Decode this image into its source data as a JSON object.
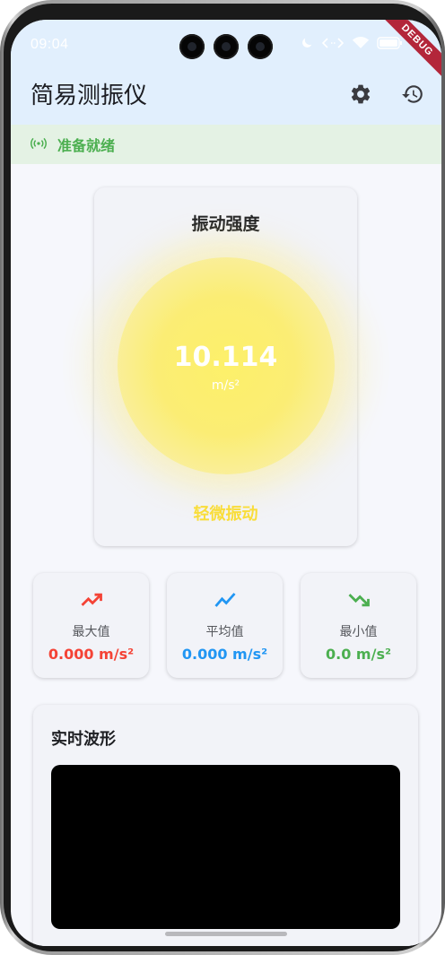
{
  "status_bar": {
    "time": "09:04",
    "icons": [
      "moon-icon",
      "code-arrows-icon",
      "wifi-icon",
      "battery-icon"
    ],
    "battery": "100",
    "ribbon": "DEBUG"
  },
  "app_bar": {
    "title": "简易测振仪",
    "actions": [
      "settings-icon",
      "history-icon"
    ]
  },
  "banner": {
    "text": "准备就绪",
    "icon": "broadcast-icon",
    "color": "#4caf50"
  },
  "intensity": {
    "title": "振动强度",
    "value": "10.114",
    "unit": "m/s²",
    "level": "轻微振动",
    "level_color": "#f9dd3a"
  },
  "stats": [
    {
      "label": "最大值",
      "value": "0.000 m/s²",
      "color": "#f44336",
      "icon": "trending-up-icon"
    },
    {
      "label": "平均值",
      "value": "0.000 m/s²",
      "color": "#2196f3",
      "icon": "show-chart-icon"
    },
    {
      "label": "最小值",
      "value": "0.0 m/s²",
      "color": "#4caf50",
      "icon": "trending-down-icon"
    }
  ],
  "waveform": {
    "title": "实时波形"
  }
}
